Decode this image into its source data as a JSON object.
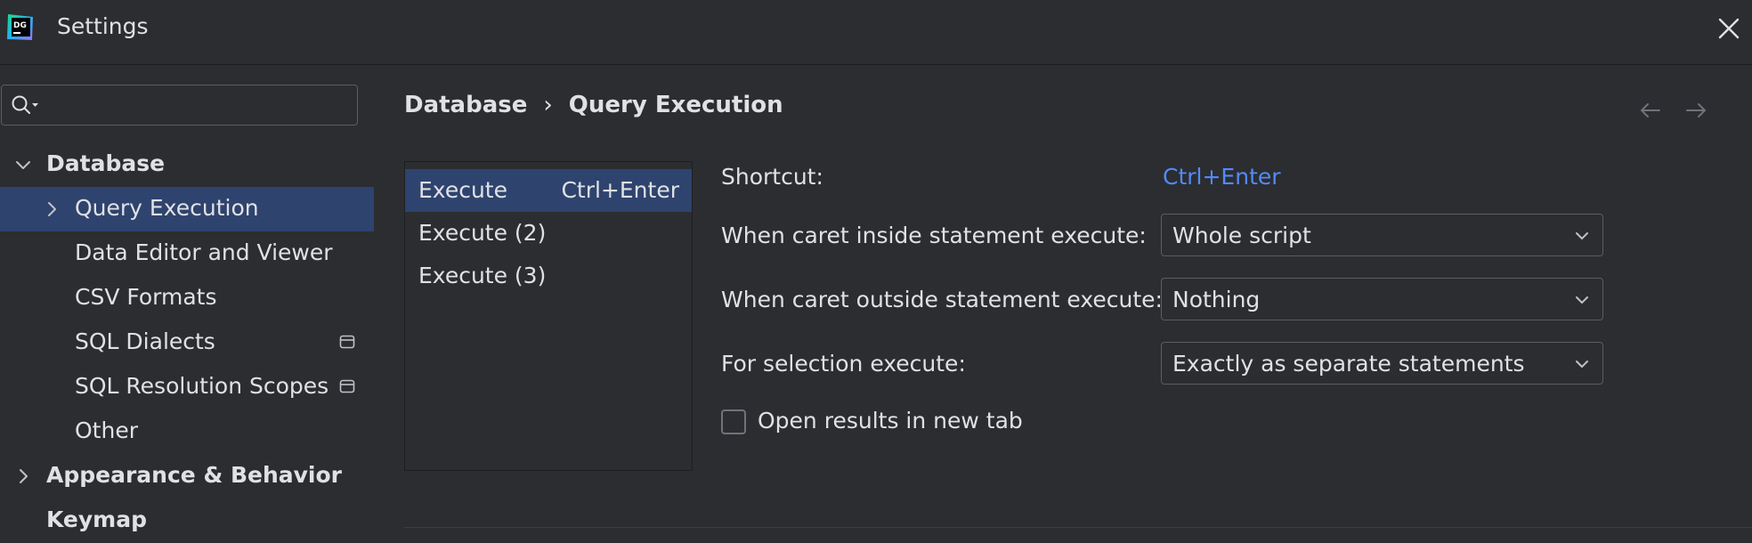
{
  "window": {
    "title": "Settings",
    "logo_text": "DG"
  },
  "search": {
    "value": "",
    "placeholder": ""
  },
  "tree": {
    "items": [
      {
        "label": "Database"
      },
      {
        "label": "Query Execution"
      },
      {
        "label": "Data Editor and Viewer"
      },
      {
        "label": "CSV Formats"
      },
      {
        "label": "SQL Dialects"
      },
      {
        "label": "SQL Resolution Scopes"
      },
      {
        "label": "Other"
      },
      {
        "label": "Appearance & Behavior"
      },
      {
        "label": "Keymap"
      }
    ]
  },
  "breadcrumb": {
    "parent": "Database",
    "separator": "›",
    "current": "Query Execution"
  },
  "execute_list": {
    "items": [
      {
        "name": "Execute",
        "shortcut": "Ctrl+Enter"
      },
      {
        "name": "Execute (2)",
        "shortcut": ""
      },
      {
        "name": "Execute (3)",
        "shortcut": ""
      }
    ]
  },
  "form": {
    "shortcut_label": "Shortcut:",
    "shortcut_value": "Ctrl+Enter",
    "inside_label": "When caret inside statement execute:",
    "inside_value": "Whole script",
    "outside_label": "When caret outside statement execute:",
    "outside_value": "Nothing",
    "selection_label": "For selection execute:",
    "selection_value": "Exactly as separate statements",
    "open_results_label": "Open results in new tab",
    "open_results_checked": false
  },
  "colors": {
    "background": "#2b2d30",
    "selection": "#2e436e",
    "link": "#548af7",
    "text": "#dfe1e5"
  },
  "icons": {
    "logo": "datagrip-logo-icon",
    "close": "close-icon",
    "search": "search-icon",
    "expand": "chevron-down-icon",
    "collapse": "chevron-right-icon",
    "project_level": "window-badge-icon",
    "back": "arrow-left-icon",
    "forward": "arrow-right-icon"
  }
}
